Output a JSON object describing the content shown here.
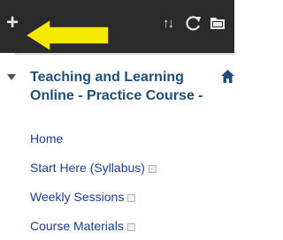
{
  "toolbar": {
    "add_label": "+",
    "sort_label": "↑↓",
    "icons": {
      "add": "plus-icon",
      "sort": "sort-icon",
      "refresh": "refresh-icon",
      "folder": "folder-icon",
      "annotation": "arrow-left-icon"
    },
    "arrow_color": "#f5e900"
  },
  "course": {
    "title": "Teaching and Learning Online - Practice Course -",
    "title_line1": "Teaching and Learning",
    "title_line2": "Online - Practice Course -",
    "accent": "#1f4e79"
  },
  "menu": {
    "items": [
      {
        "label": "Home",
        "hidden_mark": false
      },
      {
        "label": "Start Here (Syllabus)",
        "hidden_mark": true
      },
      {
        "label": "Weekly Sessions",
        "hidden_mark": true
      },
      {
        "label": "Course Materials",
        "hidden_mark": true
      }
    ],
    "link_color": "#1a3f8a"
  }
}
